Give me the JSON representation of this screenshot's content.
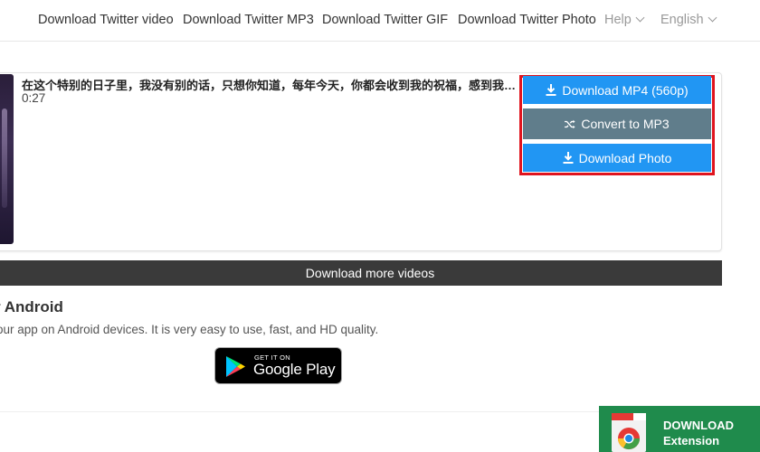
{
  "nav": {
    "items": [
      {
        "label": "Download Twitter video"
      },
      {
        "label": "Download Twitter MP3"
      },
      {
        "label": "Download Twitter GIF"
      },
      {
        "label": "Download Twitter Photo"
      }
    ],
    "help": "Help",
    "language": "English"
  },
  "video": {
    "title": "在这个特别的日子里，我没有别的话，只想你知道，每年今天，你都会收到我的祝福，感到我的爱，永远的爱！",
    "duration": "0:27"
  },
  "buttons": {
    "mp4": "Download MP4 (560p)",
    "mp3": "Convert to MP3",
    "photo": "Download Photo"
  },
  "more_bar": "Download more videos",
  "android": {
    "heading": "r Android",
    "text": "our app on Android devices. It is very easy to use, fast, and HD quality."
  },
  "google_play": {
    "small": "GET IT ON",
    "big": "Google Play"
  },
  "extension": {
    "line1": "DOWNLOAD",
    "line2": "Extension"
  },
  "colors": {
    "primary_blue": "#2196f3",
    "slate": "#607d8b",
    "highlight_red": "#e0141e",
    "dark_bar": "#3a3a3a",
    "extension_green": "#1f8b4c"
  }
}
